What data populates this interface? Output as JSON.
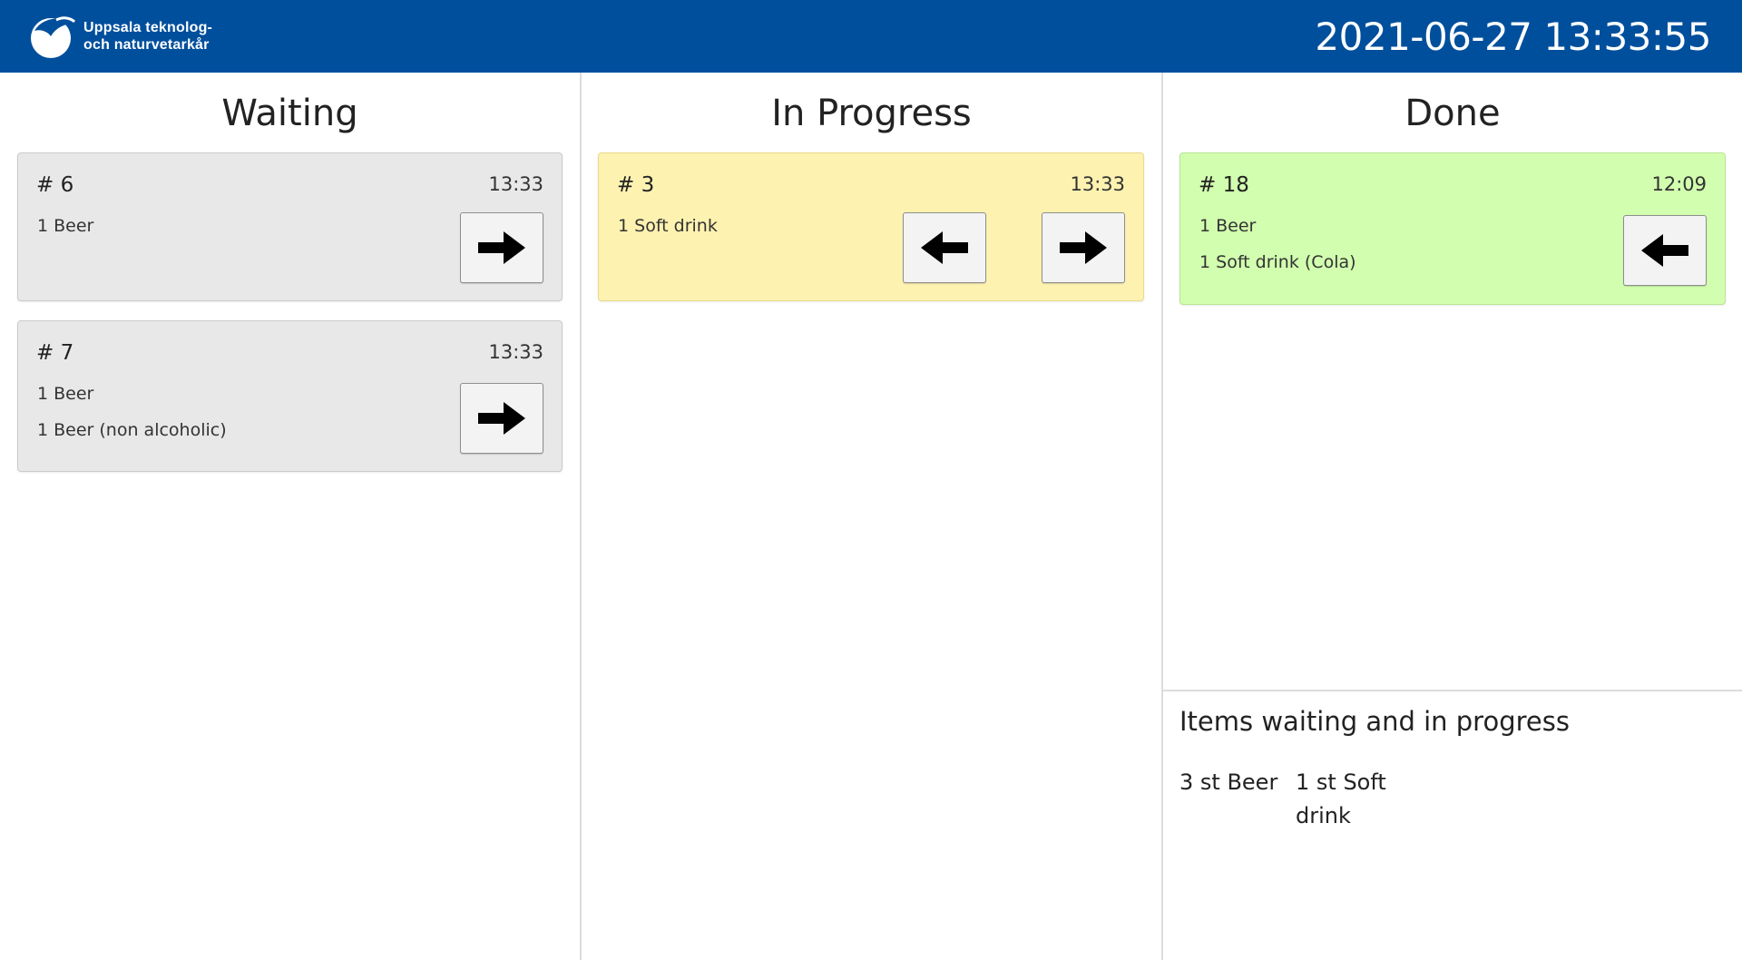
{
  "header": {
    "logo_line1": "Uppsala teknolog-",
    "logo_line2": "och naturvetarkår",
    "datetime": "2021-06-27 13:33:55",
    "background_color": "#004f9d"
  },
  "columns": {
    "waiting": {
      "title": "Waiting",
      "cards": [
        {
          "number": "# 6",
          "time": "13:33",
          "items": [
            "1 Beer"
          ],
          "color": "#e8e8e8"
        },
        {
          "number": "# 7",
          "time": "13:33",
          "items": [
            "1 Beer",
            "1 Beer (non alcoholic)"
          ],
          "color": "#e8e8e8"
        }
      ]
    },
    "in_progress": {
      "title": "In Progress",
      "cards": [
        {
          "number": "# 3",
          "time": "13:33",
          "items": [
            "1 Soft drink"
          ],
          "color": "#fdf2b0"
        }
      ]
    },
    "done": {
      "title": "Done",
      "cards": [
        {
          "number": "# 18",
          "time": "12:09",
          "items": [
            "1 Beer",
            "1 Soft drink (Cola)"
          ],
          "color": "#d2feaf"
        }
      ]
    }
  },
  "summary": {
    "title": "Items waiting and in progress",
    "items": [
      {
        "line1": "3 st Beer",
        "line2": ""
      },
      {
        "line1": "1 st Soft",
        "line2": "drink"
      }
    ]
  },
  "icons": {
    "forward": "arrow-right-icon",
    "back": "arrow-left-icon"
  }
}
